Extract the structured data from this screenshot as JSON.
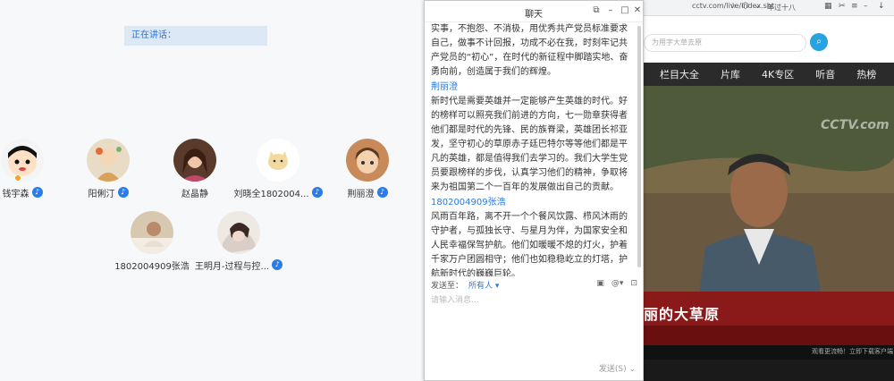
{
  "meeting": {
    "status_text": "正在讲话：",
    "participants": [
      {
        "name": "钱宇森",
        "avatar": "cartoon-avatar",
        "host": true
      },
      {
        "name": "阳俐汀",
        "avatar": "illustration-avatar",
        "host": false
      },
      {
        "name": "赵晶静",
        "avatar": "photo-avatar",
        "host": false
      },
      {
        "name": "刘晓全1802004...",
        "avatar": "cat-avatar",
        "host": false
      },
      {
        "name": "荆丽澄",
        "avatar": "anime-avatar",
        "host": false
      },
      {
        "name": "1802004909张浩",
        "avatar": "photo-avatar",
        "host": false
      },
      {
        "name": "王明月-过程与控...",
        "avatar": "sketch-avatar",
        "host": false
      }
    ]
  },
  "chat": {
    "title": "聊天",
    "messages": [
      {
        "sender": "",
        "text": "实事，不抱怨、不消极，用优秀共产党员标准要求自己，做事不计回报，功成不必在我，时刻牢记共产党员的“初心”，在时代的新征程中脚踏实地、奋勇向前，创造属于我们的辉煌。"
      },
      {
        "sender": "荆丽澄",
        "text": "新时代是需要英雄并一定能够产生英雄的时代。好的榜样可以照亮我们前进的方向，七一勋章获得者他们都是时代的先锋、民的族脊梁，英雄团长祁亚发，坚守初心的草原赤子廷巴特尔等等他们都是平凡的英雄，都是值得我们去学习的。我们大学生党员要跟榜样的步伐，认真学习他们的精神，争取将来为祖国第二个一百年的发展做出自己的贡献。"
      },
      {
        "sender": "1802004909张浩",
        "text": "风雨百年路，离不开一个个餐风饮露、栉风沐雨的守护者，与孤独长守、与星月为伴，为国家安全和人民幸福保驾护航。他们如暖暖不熄的灯火，护着千家万户团圆相守；他们也如稳稳屹立的灯塔，护航新时代的巍巍巨轮。"
      }
    ],
    "sendto_label": "发送至：",
    "sendto_target": "所有人",
    "input_placeholder": "请输入消息...",
    "send_label": "发送(S)"
  },
  "browser": {
    "url": "cctv.com/live/index.sht",
    "ext_tab": "年过十八",
    "search_placeholder": "为用字大草去原",
    "nav_items": [
      "栏目大全",
      "片库",
      "4K专区",
      "听音",
      "热榜"
    ],
    "video_logo": "CCTV.com",
    "subtitle": "丽的大草原",
    "bottom_text": "观看更流畅！立即下载客户端"
  }
}
